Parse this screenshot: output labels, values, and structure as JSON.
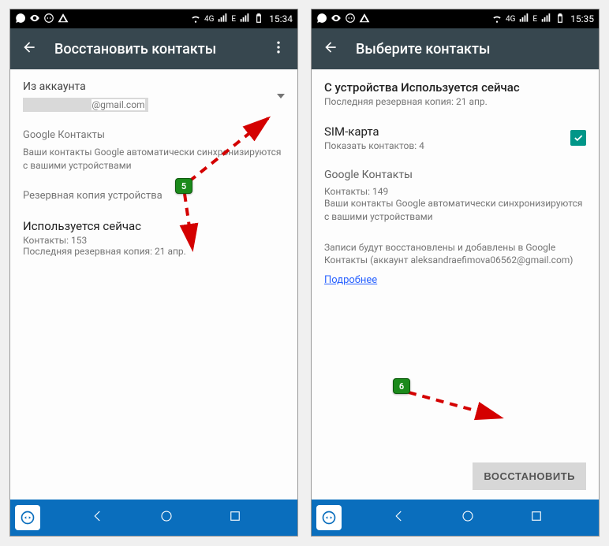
{
  "left": {
    "status_time": "15:34",
    "appbar_title": "Восстановить контакты",
    "from_account_label": "Из аккаунта",
    "account_email_suffix": "@gmail.com",
    "google_contacts_header": "Google Контакты",
    "google_contacts_sub": "Ваши контакты Google автоматически синхронизируются с вашими устройствами",
    "backup_header": "Резервная копия устройства",
    "device_now_title": "Используется сейчас",
    "device_now_count": "Контакты: 153",
    "device_now_backup": "Последняя резервная копия: 21 апр."
  },
  "right": {
    "status_time": "15:35",
    "appbar_title": "Выберите контакты",
    "device_title": "С устройства Используется сейчас",
    "device_backup": "Последняя резервная копия: 21 апр.",
    "sim_title": "SIM-карта",
    "sim_count": "Показать контактов: 4",
    "google_contacts_header": "Google Контакты",
    "google_contacts_count": "Контакты: 149",
    "google_contacts_sub": "Ваши контакты Google автоматически синхронизируются с вашими устройствами",
    "restore_info": "Записи будут восстановлены и добавлены в Google Контакты (аккаунт aleksandraefimova06562@gmail.com)",
    "learn_more": "Подробнее",
    "restore_btn": "ВОССТАНОВИТЬ"
  },
  "annotations": {
    "step5": "5",
    "step6": "6"
  },
  "status_4g": "4G"
}
